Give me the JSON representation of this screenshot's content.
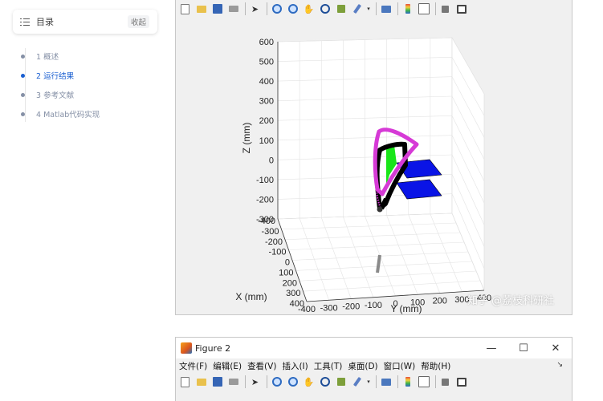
{
  "toc": {
    "title": "目录",
    "collapse_label": "收起",
    "items": [
      {
        "label": "1 概述"
      },
      {
        "label": "2 运行结果"
      },
      {
        "label": "3 参考文献"
      },
      {
        "label": "4 Matlab代码实现"
      }
    ]
  },
  "figure1": {
    "toolbar_icons": [
      "new-icon",
      "open-icon",
      "save-icon",
      "print-icon",
      "pointer-icon",
      "zoom-in-icon",
      "zoom-out-icon",
      "pan-icon",
      "rotate-icon",
      "data-cursor-icon",
      "brush-icon",
      "link-icon",
      "colorbar-icon",
      "legend-icon",
      "hide-plot-tools-icon",
      "show-plot-tools-icon"
    ],
    "axes": {
      "zlabel": "Z (mm)",
      "xlabel": "X (mm)",
      "ylabel": "Y (mm)",
      "z_ticks": [
        "600",
        "500",
        "400",
        "300",
        "200",
        "100",
        "0",
        "-100",
        "-200",
        "-300"
      ],
      "x_ticks": [
        "-400",
        "-300",
        "-200",
        "-100",
        "0",
        "100",
        "200",
        "300",
        "400"
      ],
      "y_ticks": [
        "-400",
        "-300",
        "-200",
        "-100",
        "0",
        "100",
        "200",
        "300",
        "400"
      ]
    },
    "colors": {
      "trajectory_outer": "#d63ad6",
      "trajectory_inner": "#000000",
      "planes": "#0a14e6",
      "green_region": "#19e619",
      "base_link": "#808080"
    }
  },
  "watermark": "知乎 @荔枝科研社",
  "figure2": {
    "title": "Figure 2",
    "window_controls": {
      "minimize": "—",
      "maximize": "☐",
      "close": "✕"
    },
    "menus": [
      "文件(F)",
      "编辑(E)",
      "查看(V)",
      "插入(I)",
      "工具(T)",
      "桌面(D)",
      "窗口(W)",
      "帮助(H)"
    ],
    "corner_glyph": "↘"
  }
}
